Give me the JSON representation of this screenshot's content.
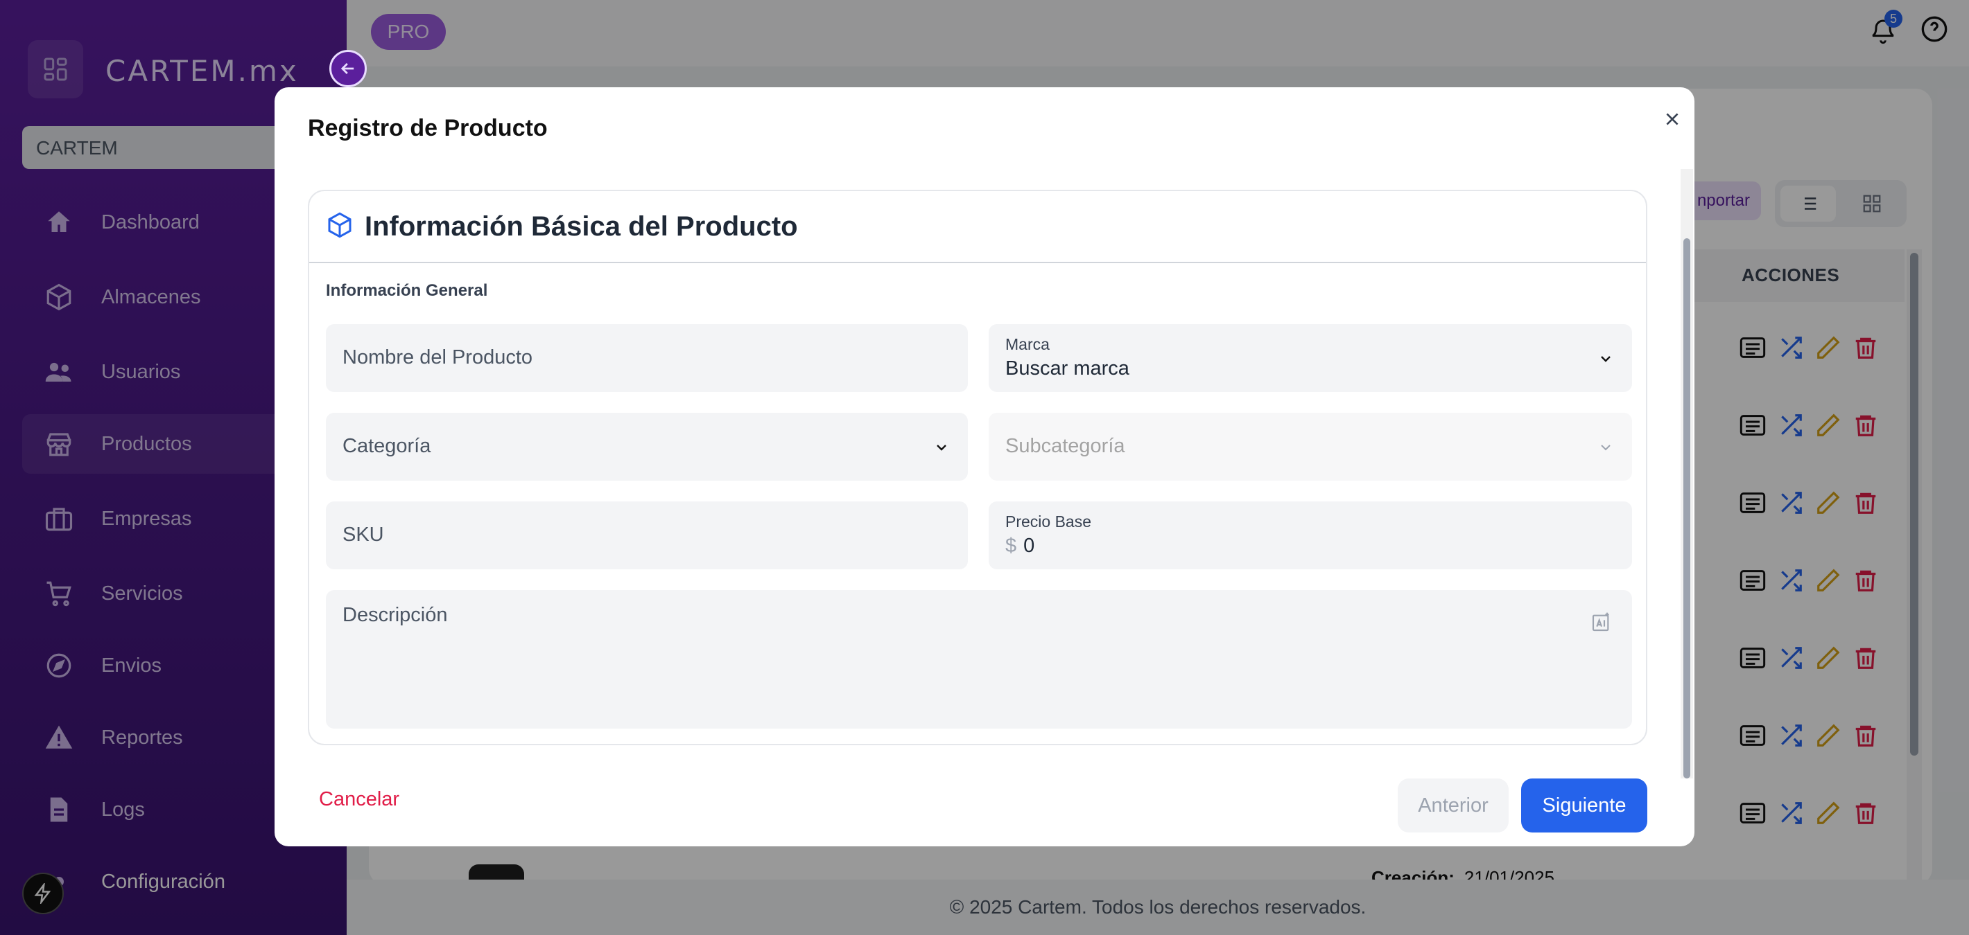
{
  "app": {
    "logo_text": "CARTEM.mx",
    "org_value": "CARTEM"
  },
  "sidebar": {
    "items": [
      {
        "label": "Dashboard",
        "icon": "home-icon"
      },
      {
        "label": "Almacenes",
        "icon": "cube-icon"
      },
      {
        "label": "Usuarios",
        "icon": "users-icon"
      },
      {
        "label": "Productos",
        "icon": "store-icon",
        "active": true
      },
      {
        "label": "Empresas",
        "icon": "briefcase-icon"
      },
      {
        "label": "Servicios",
        "icon": "cart-icon"
      },
      {
        "label": "Envios",
        "icon": "compass-icon"
      },
      {
        "label": "Reportes",
        "icon": "warning-icon"
      },
      {
        "label": "Logs",
        "icon": "file-icon"
      },
      {
        "label": "Configuración",
        "icon": "gear-icon"
      }
    ]
  },
  "topbar": {
    "pro_label": "PRO",
    "notification_count": "5"
  },
  "background": {
    "import_label": "nportar",
    "acciones_header": "ACCIONES",
    "creacion_label": "Creación:",
    "creacion_date": "21/01/2025",
    "footer": "© 2025 Cartem. Todos los derechos reservados."
  },
  "modal": {
    "title": "Registro de Producto",
    "section_title": "Información Básica del Producto",
    "subheading": "Información General",
    "fields": {
      "nombre_placeholder": "Nombre del Producto",
      "marca_label": "Marca",
      "marca_value": "Buscar marca",
      "categoria_placeholder": "Categoría",
      "subcategoria_placeholder": "Subcategoría",
      "sku_placeholder": "SKU",
      "precio_label": "Precio Base",
      "precio_currency": "$",
      "precio_value": "0",
      "descripcion_placeholder": "Descripción"
    },
    "buttons": {
      "cancel": "Cancelar",
      "previous": "Anterior",
      "next": "Siguiente"
    }
  },
  "colors": {
    "primary": "#2563eb",
    "sidebar": "#4a1a86",
    "cancel": "#e11d48"
  }
}
